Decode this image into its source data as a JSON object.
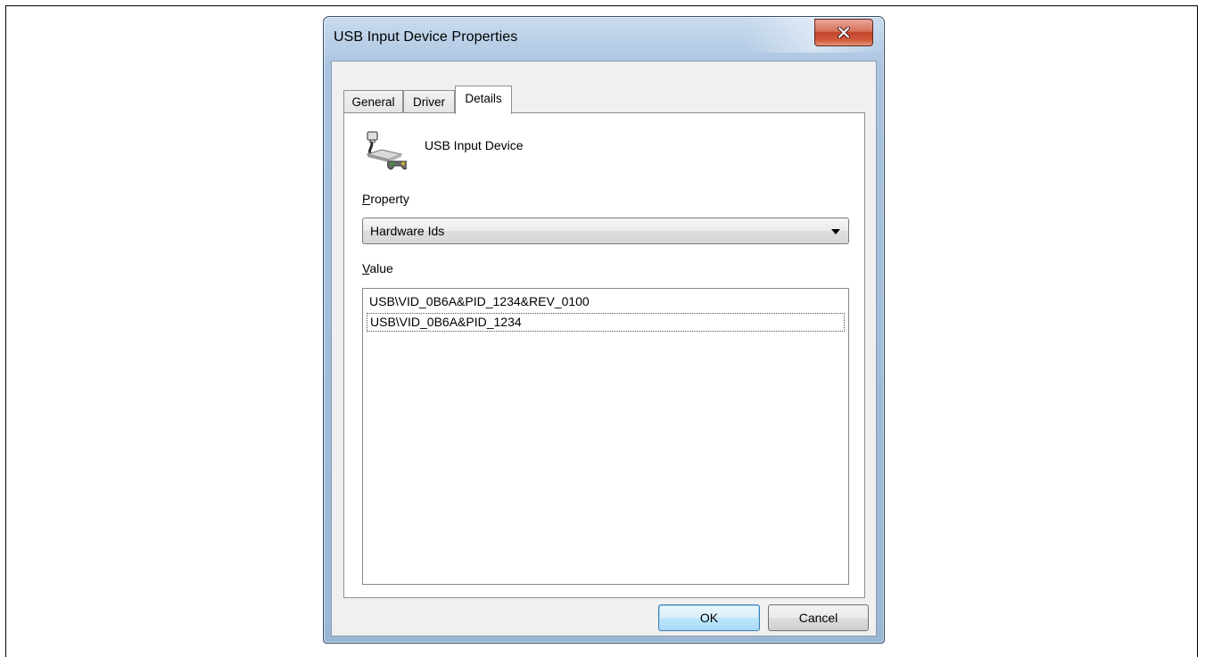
{
  "window": {
    "title": "USB Input Device Properties",
    "close_glyph": "X"
  },
  "tabs": [
    {
      "label": "General",
      "active": false
    },
    {
      "label": "Driver",
      "active": false
    },
    {
      "label": "Details",
      "active": true
    }
  ],
  "device": {
    "icon": "usb-gamepad-icon",
    "name": "USB Input Device"
  },
  "property": {
    "label_accel": "P",
    "label_rest": "roperty",
    "selected": "Hardware Ids"
  },
  "value": {
    "label_accel": "V",
    "label_rest": "alue",
    "items": [
      "USB\\VID_0B6A&PID_1234&REV_0100",
      "USB\\VID_0B6A&PID_1234"
    ],
    "focused_index": 1
  },
  "buttons": {
    "ok": "OK",
    "cancel": "Cancel"
  },
  "colors": {
    "title_bar": "#a9c3e0",
    "close_button": "#c2432b",
    "default_button": "#bee6fd"
  }
}
